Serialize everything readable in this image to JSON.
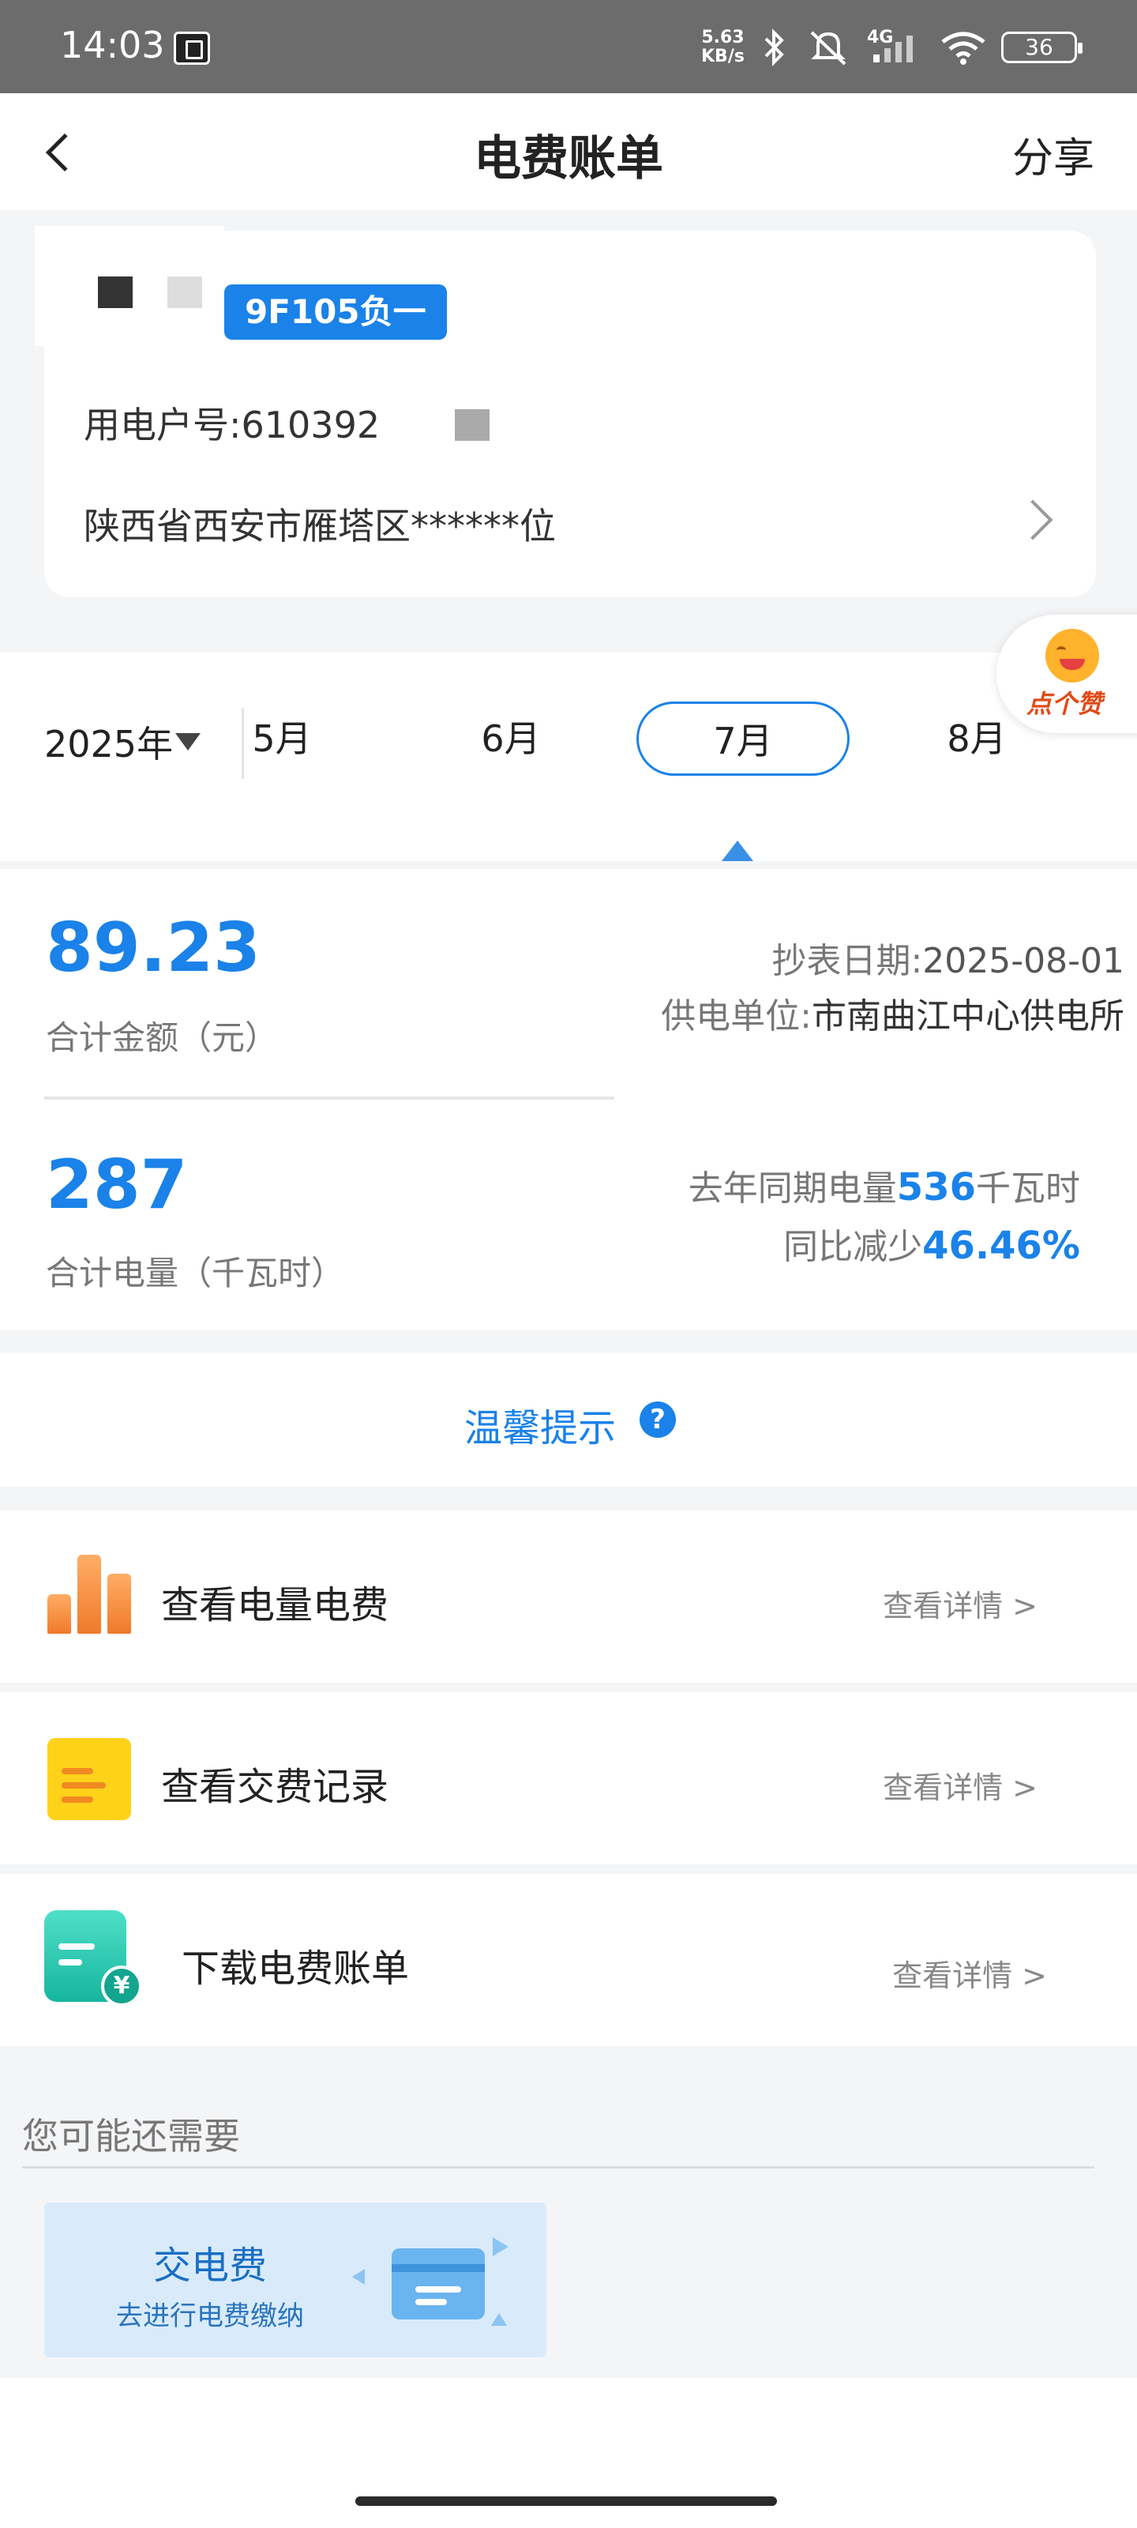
{
  "status_bar": {
    "time": "14:03",
    "net_speed_value": "5.63",
    "net_speed_unit": "KB/s",
    "network": "4G",
    "battery": "36"
  },
  "header": {
    "title": "电费账单",
    "share_label": "分享"
  },
  "account": {
    "tag": "9F105负一",
    "number": "用电户号:610392",
    "address": "陕西省西安市雁塔区******位"
  },
  "months": {
    "year": "2025年",
    "tabs": [
      {
        "label": "5月",
        "active": false
      },
      {
        "label": "6月",
        "active": false
      },
      {
        "label": "7月",
        "active": true
      },
      {
        "label": "8月",
        "active": false
      }
    ]
  },
  "like": {
    "label": "点个赞"
  },
  "summary": {
    "amount": "89.23",
    "amount_label": "合计金额（元）",
    "meter_date_label": "抄表日期:",
    "meter_date": "2025-08-01",
    "supply_unit_label": "供电单位:",
    "supply_unit": "市南曲江中心供电所",
    "usage": "287",
    "usage_label": "合计电量（千瓦时）",
    "last_year_prefix": "去年同期电量",
    "last_year_value": "536",
    "last_year_unit": "千瓦时",
    "yoy_prefix": "同比减少",
    "yoy_value": "46.46%"
  },
  "tips": {
    "label": "温馨提示",
    "icon": "?"
  },
  "actions": [
    {
      "label": "查看电量电费",
      "link": "查看详情 >"
    },
    {
      "label": "查看交费记录",
      "link": "查看详情 >"
    },
    {
      "label": "下载电费账单",
      "link": "查看详情 >"
    }
  ],
  "recommend": {
    "title": "您可能还需要",
    "card_title": "交电费",
    "card_subtitle": "去进行电费缴纳"
  },
  "colors": {
    "accent": "#1a82e8",
    "status_bar": "#6c6c6c",
    "background": "#f4f5f7"
  }
}
